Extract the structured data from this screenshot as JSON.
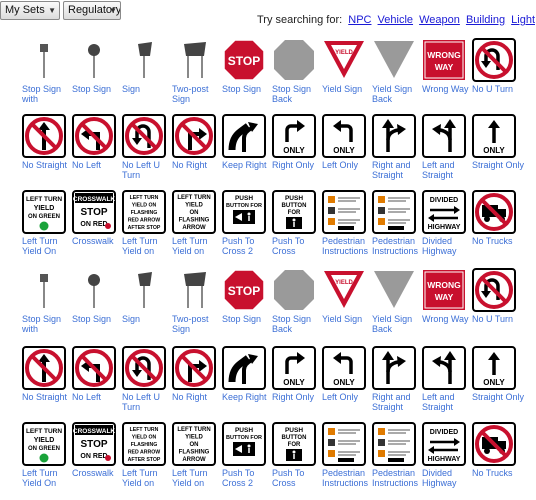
{
  "toolbar": {
    "set_select": "My Sets",
    "type_select": "Regulatory S",
    "search_hint": "Try searching for:",
    "suggestions": [
      "NPC",
      "Vehicle",
      "Weapon",
      "Building",
      "Light"
    ]
  },
  "colors": {
    "accent": "#3c6fd6",
    "link": "#1a1ad6",
    "red": "#c8102e"
  },
  "rows": [
    {
      "items": [
        {
          "label": "Stop Sign with",
          "icon": "stop-sign-with-icon"
        },
        {
          "label": "Stop Sign",
          "icon": "stop-sign-model-icon"
        },
        {
          "label": "Sign",
          "icon": "sign-model-icon"
        },
        {
          "label": "Two-post Sign",
          "icon": "two-post-sign-icon"
        },
        {
          "label": "Stop Sign",
          "icon": "stop-sign-icon",
          "text": "STOP"
        },
        {
          "label": "Stop Sign Back",
          "icon": "stop-sign-back-icon"
        },
        {
          "label": "Yield Sign",
          "icon": "yield-sign-icon",
          "text": "YIELD"
        },
        {
          "label": "Yield Sign Back",
          "icon": "yield-sign-back-icon"
        },
        {
          "label": "Wrong Way",
          "icon": "wrong-way-icon",
          "text": [
            "WRONG",
            "WAY"
          ]
        },
        {
          "label": "No U Turn",
          "icon": "no-u-turn-icon"
        }
      ]
    },
    {
      "items": [
        {
          "label": "No Straight",
          "icon": "no-straight-icon"
        },
        {
          "label": "No Left",
          "icon": "no-left-icon"
        },
        {
          "label": "No Left U Turn",
          "icon": "no-left-u-turn-icon"
        },
        {
          "label": "No Right",
          "icon": "no-right-icon"
        },
        {
          "label": "Keep Right",
          "icon": "keep-right-icon"
        },
        {
          "label": "Right Only",
          "icon": "right-only-icon",
          "text": "ONLY"
        },
        {
          "label": "Left Only",
          "icon": "left-only-icon",
          "text": "ONLY"
        },
        {
          "label": "Right and Straight",
          "icon": "right-and-straight-icon"
        },
        {
          "label": "Left and Straight",
          "icon": "left-and-straight-icon"
        },
        {
          "label": "Straight Only",
          "icon": "straight-only-icon",
          "text": "ONLY"
        }
      ]
    },
    {
      "items": [
        {
          "label": "Left Turn Yield On",
          "icon": "left-turn-yield-on-green-icon",
          "text": [
            "LEFT TURN",
            "YIELD",
            "ON GREEN"
          ]
        },
        {
          "label": "Crosswalk",
          "icon": "crosswalk-stop-on-red-icon",
          "text": [
            "CROSSWALK",
            "STOP",
            "ON RED"
          ]
        },
        {
          "label": "Left Turn Yield on",
          "icon": "left-turn-yield-red-arrow-icon",
          "text": [
            "LEFT TURN",
            "YIELD ON",
            "FLASHING",
            "RED ARROW",
            "AFTER STOP"
          ]
        },
        {
          "label": "Left Turn Yield on",
          "icon": "left-turn-yield-flashing-arrow-icon",
          "text": [
            "LEFT TURN",
            "YIELD",
            "ON",
            "FLASHING",
            "ARROW"
          ]
        },
        {
          "label": "Push To Cross 2",
          "icon": "push-to-cross-2-icon",
          "text": [
            "PUSH",
            "BUTTON FOR"
          ]
        },
        {
          "label": "Push To Cross",
          "icon": "push-to-cross-icon",
          "text": [
            "PUSH",
            "BUTTON",
            "FOR"
          ]
        },
        {
          "label": "Pedestrian Instructions",
          "icon": "pedestrian-instructions-icon"
        },
        {
          "label": "Pedestrian Instructions",
          "icon": "pedestrian-instructions-2-icon"
        },
        {
          "label": "Divided Highway",
          "icon": "divided-highway-icon",
          "text": "DIVIDED\nHIGHWAY"
        },
        {
          "label": "No Trucks",
          "icon": "no-trucks-icon"
        }
      ]
    },
    {
      "items": [
        {
          "label": "Stop Sign with",
          "icon": "stop-sign-with-icon"
        },
        {
          "label": "Stop Sign",
          "icon": "stop-sign-model-icon"
        },
        {
          "label": "Sign",
          "icon": "sign-model-icon"
        },
        {
          "label": "Two-post Sign",
          "icon": "two-post-sign-icon"
        },
        {
          "label": "Stop Sign",
          "icon": "stop-sign-icon",
          "text": "STOP"
        },
        {
          "label": "Stop Sign Back",
          "icon": "stop-sign-back-icon"
        },
        {
          "label": "Yield Sign",
          "icon": "yield-sign-icon",
          "text": "YIELD"
        },
        {
          "label": "Yield Sign Back",
          "icon": "yield-sign-back-icon"
        },
        {
          "label": "Wrong Way",
          "icon": "wrong-way-icon",
          "text": [
            "WRONG",
            "WAY"
          ]
        },
        {
          "label": "No U Turn",
          "icon": "no-u-turn-icon"
        }
      ]
    },
    {
      "items": [
        {
          "label": "No Straight",
          "icon": "no-straight-icon"
        },
        {
          "label": "No Left",
          "icon": "no-left-icon"
        },
        {
          "label": "No Left U Turn",
          "icon": "no-left-u-turn-icon"
        },
        {
          "label": "No Right",
          "icon": "no-right-icon"
        },
        {
          "label": "Keep Right",
          "icon": "keep-right-icon"
        },
        {
          "label": "Right Only",
          "icon": "right-only-icon",
          "text": "ONLY"
        },
        {
          "label": "Left Only",
          "icon": "left-only-icon",
          "text": "ONLY"
        },
        {
          "label": "Right and Straight",
          "icon": "right-and-straight-icon"
        },
        {
          "label": "Left and Straight",
          "icon": "left-and-straight-icon"
        },
        {
          "label": "Straight Only",
          "icon": "straight-only-icon",
          "text": "ONLY"
        }
      ]
    },
    {
      "items": [
        {
          "label": "Left Turn Yield On",
          "icon": "left-turn-yield-on-green-icon",
          "text": [
            "LEFT TURN",
            "YIELD",
            "ON GREEN"
          ]
        },
        {
          "label": "Crosswalk",
          "icon": "crosswalk-stop-on-red-icon",
          "text": [
            "CROSSWALK",
            "STOP",
            "ON RED"
          ]
        },
        {
          "label": "Left Turn Yield on",
          "icon": "left-turn-yield-red-arrow-icon",
          "text": [
            "LEFT TURN",
            "YIELD ON",
            "FLASHING",
            "RED ARROW",
            "AFTER STOP"
          ]
        },
        {
          "label": "Left Turn Yield on",
          "icon": "left-turn-yield-flashing-arrow-icon",
          "text": [
            "LEFT TURN",
            "YIELD",
            "ON",
            "FLASHING",
            "ARROW"
          ]
        },
        {
          "label": "Push To Cross 2",
          "icon": "push-to-cross-2-icon",
          "text": [
            "PUSH",
            "BUTTON FOR"
          ]
        },
        {
          "label": "Push To Cross",
          "icon": "push-to-cross-icon",
          "text": [
            "PUSH",
            "BUTTON",
            "FOR"
          ]
        },
        {
          "label": "Pedestrian Instructions",
          "icon": "pedestrian-instructions-icon"
        },
        {
          "label": "Pedestrian Instructions",
          "icon": "pedestrian-instructions-2-icon"
        },
        {
          "label": "Divided Highway",
          "icon": "divided-highway-icon",
          "text": "DIVIDED\nHIGHWAY"
        },
        {
          "label": "No Trucks",
          "icon": "no-trucks-icon"
        }
      ]
    }
  ]
}
